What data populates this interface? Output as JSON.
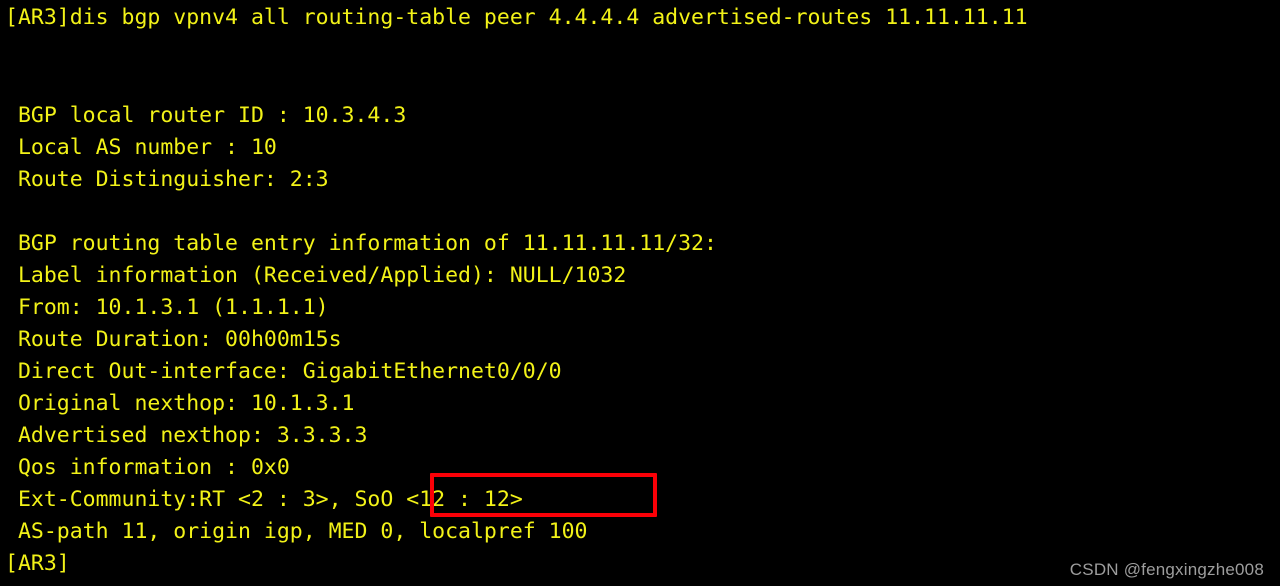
{
  "terminal": {
    "background_color": "#000000",
    "text_color": "#f2f218",
    "prompt_device": "[AR3]",
    "command_line": "[AR3]dis bgp vpnv4 all routing-table peer 4.4.4.4 advertised-routes 11.11.11.11",
    "blank_1": "",
    "blank_2": "",
    "header": {
      "local_router_id_line": " BGP local router ID : 10.3.4.3",
      "local_as_number_line": " Local AS number : 10",
      "route_distinguisher_line": " Route Distinguisher: 2:3"
    },
    "blank_3": "",
    "entry": {
      "table_entry_line": " BGP routing table entry information of 11.11.11.11/32:",
      "label_information_line": " Label information (Received/Applied): NULL/1032",
      "from_line": " From: 10.1.3.1 (1.1.1.1)",
      "route_duration_line": " Route Duration: 00h00m15s",
      "out_interface_line": " Direct Out-interface: GigabitEthernet0/0/0",
      "original_nexthop_line": " Original nexthop: 10.1.3.1",
      "advertised_nexthop_line": " Advertised nexthop: 3.3.3.3",
      "qos_information_line": " Qos information : 0x0",
      "ext_community_line": " Ext-Community:RT <2 : 3>, SoO <12 : 12>",
      "as_path_line": " AS-path 11, origin igp, MED 0, localpref 100"
    },
    "trailing_prompt": "[AR3]",
    "values": {
      "bgp_local_router_id": "10.3.4.3",
      "local_as_number": "10",
      "route_distinguisher": "2:3",
      "prefix": "11.11.11.11/32",
      "label_received": "NULL",
      "label_applied": "1032",
      "from_peer": "10.1.3.1",
      "from_router_id": "1.1.1.1",
      "route_duration": "00h00m15s",
      "out_interface": "GigabitEthernet0/0/0",
      "original_nexthop": "10.1.3.1",
      "advertised_nexthop": "3.3.3.3",
      "qos_information": "0x0",
      "ext_community_rt": "RT <2 : 3>",
      "ext_community_soo": "SoO <12 : 12>",
      "as_path": "11",
      "origin": "igp",
      "med": "0",
      "localpref": "100",
      "peer": "4.4.4.4",
      "advertised_routes_prefix": "11.11.11.11"
    }
  },
  "annotation": {
    "highlight_color": "#fb0007",
    "highlight_target_text": "SoO <12 : 12>"
  },
  "watermark": {
    "text": "CSDN @fengxingzhe008",
    "color": "#9d9d9d"
  }
}
